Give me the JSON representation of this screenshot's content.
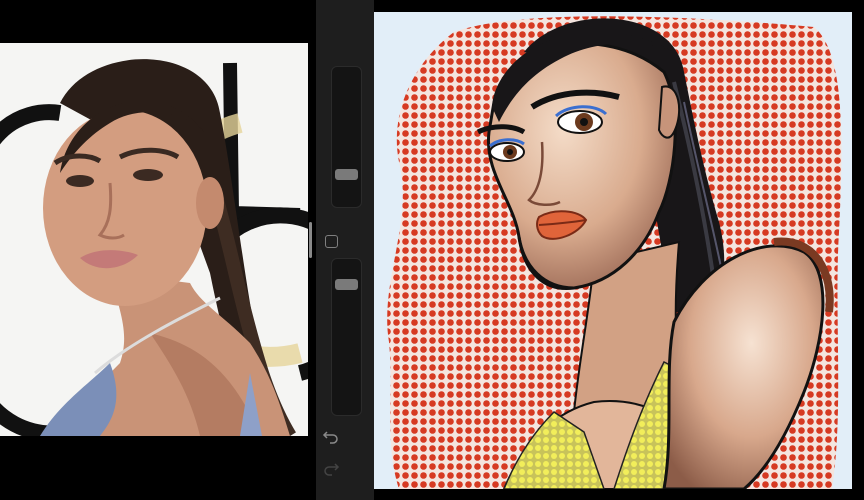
{
  "app": {
    "name": "drawing-app"
  },
  "reference": {
    "photo_kind": "red carpet portrait photo"
  },
  "toolbar": {
    "brush_size": 0.79,
    "opacity": 0.08,
    "modifier_icon": "square-icon",
    "undo_icon": "undo-arrow-icon",
    "redo_icon": "redo-arrow-icon"
  },
  "canvas": {
    "artwork_kind": "pop-art caricature illustration",
    "halftone_color": "#d63a22",
    "background_color": "#e2eef8",
    "top_color": "#f2ee5a"
  },
  "colors": {
    "ui_dark": "#1e1e1e",
    "slider_thumb": "#7a7a7a",
    "icon_gray": "#7f7f7f"
  }
}
